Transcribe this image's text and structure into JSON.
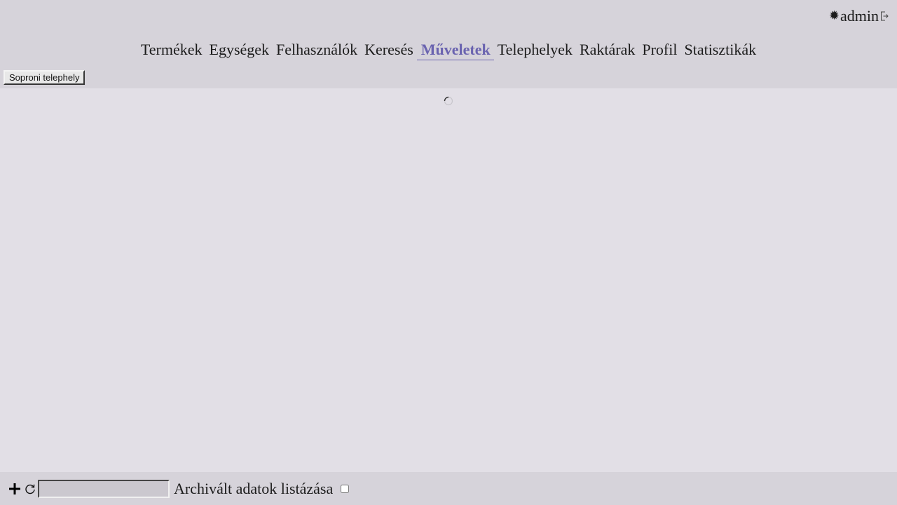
{
  "header": {
    "user": {
      "theme_icon": "sun-icon",
      "theme_glyph": "✹",
      "name": "admin",
      "logout_icon": "logout-icon"
    },
    "nav": {
      "items": [
        {
          "label": "Termékek",
          "active": false
        },
        {
          "label": "Egységek",
          "active": false
        },
        {
          "label": "Felhasználók",
          "active": false
        },
        {
          "label": "Keresés",
          "active": false
        },
        {
          "label": "Műveletek",
          "active": true
        },
        {
          "label": "Telephelyek",
          "active": false
        },
        {
          "label": "Raktárak",
          "active": false
        },
        {
          "label": "Profil",
          "active": false
        },
        {
          "label": "Statisztikák",
          "active": false
        }
      ]
    },
    "site_button_label": "Soproni telephely"
  },
  "content": {
    "loading_icon": "spinner-icon"
  },
  "footer": {
    "add_icon": "plus-icon",
    "refresh_icon": "refresh-icon",
    "search_value": "",
    "archive_label": "Archivált adatok listázása",
    "archive_checked": false
  },
  "colors": {
    "header_bg": "#d6d3da",
    "content_bg": "#e2dfe6",
    "active_nav": "#6b64b0"
  }
}
